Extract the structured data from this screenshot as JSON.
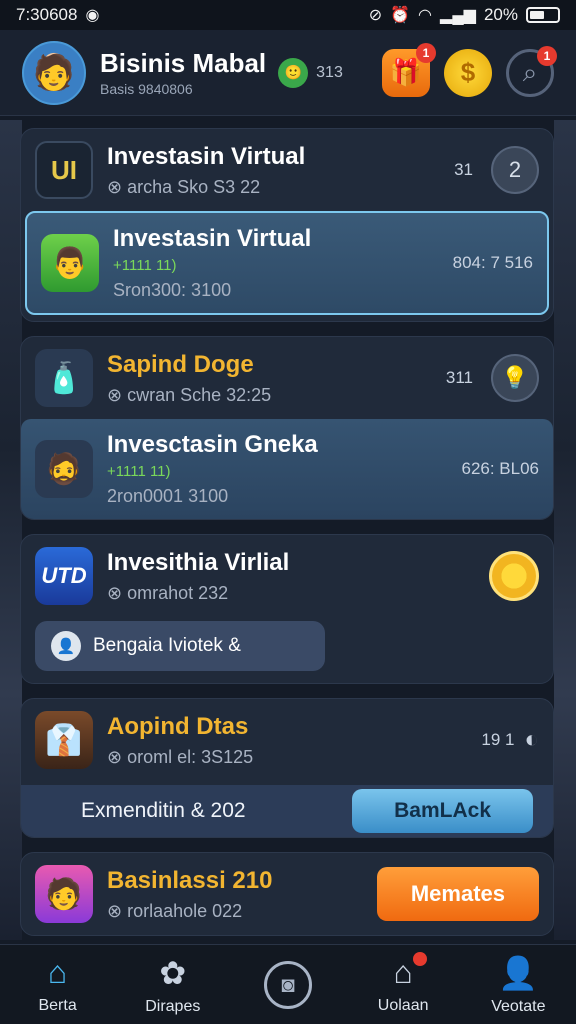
{
  "status": {
    "time": "7:30608",
    "right_text": "20%"
  },
  "header": {
    "title": "Bisinis Mabal",
    "subtitle": "Basis 9840806",
    "badge_text": "313",
    "gift_badge": "1",
    "search_badge": "1"
  },
  "groups": [
    {
      "rows": [
        {
          "icon": "trophy-icon",
          "title": "Investasin Virtual",
          "sub": "archa Sko S3 22",
          "right": "31",
          "title_color": "#ffffff"
        },
        {
          "icon": "avatar-icon",
          "title": "Investasin Virtual",
          "sub2": "+1111 11)",
          "sub": "Sron300: 3100",
          "right": "804: 7 516",
          "highlight": true
        }
      ]
    },
    {
      "rows": [
        {
          "icon": "shop-icon",
          "title": "Sapind Doge",
          "sub": "cwran Sche 32:25",
          "right": "311",
          "title_color": "#f2b531"
        },
        {
          "icon": "avatar-icon",
          "title": "Invesctasin Gneka",
          "sub2": "+1111 11)",
          "sub": "2ron0001 3100",
          "right": "626: BL06",
          "highlight": true
        }
      ]
    },
    {
      "rows": [
        {
          "icon": "brand-icon",
          "icon_text": "UTD",
          "title": "Invesithia Virlial",
          "sub": "omrahot 232"
        }
      ],
      "pill": "Bengaia Iviotek &"
    },
    {
      "rows": [
        {
          "icon": "avatar-icon",
          "title": "Aopind Dtas",
          "sub": "oroml el: 3S125",
          "right": "19  1",
          "title_color": "#f2b531"
        }
      ],
      "bar_text": "Exmenditin & 202",
      "bar_button": "BamLAck"
    },
    {
      "rows": [
        {
          "icon": "avatar-icon",
          "title": "Basinlassi 210",
          "sub": "rorlaahole 022",
          "title_color": "#f2b531"
        }
      ],
      "button": "Memates"
    }
  ],
  "nav": [
    {
      "label": "Berta",
      "icon": "home-icon"
    },
    {
      "label": "Dirapes",
      "icon": "apps-icon"
    },
    {
      "label": "",
      "icon": "camera-icon"
    },
    {
      "label": "Uolaan",
      "icon": "shop-icon"
    },
    {
      "label": "Veotate",
      "icon": "profile-icon"
    }
  ]
}
